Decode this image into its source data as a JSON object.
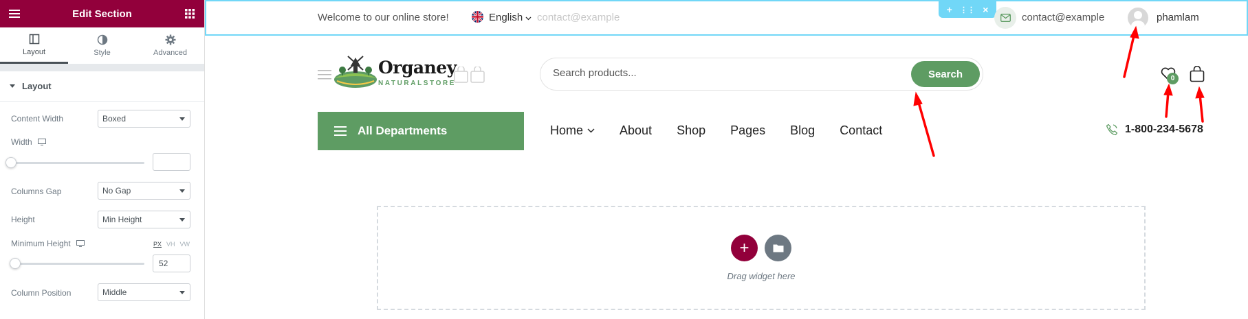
{
  "panel": {
    "title": "Edit Section",
    "tabs": [
      {
        "label": "Layout",
        "icon": "layout-icon",
        "active": true
      },
      {
        "label": "Style",
        "icon": "style-icon",
        "active": false
      },
      {
        "label": "Advanced",
        "icon": "gear-icon",
        "active": false
      }
    ],
    "section_title": "Layout",
    "controls": {
      "content_width": {
        "label": "Content Width",
        "value": "Boxed"
      },
      "width": {
        "label": "Width",
        "value": ""
      },
      "columns_gap": {
        "label": "Columns Gap",
        "value": "No Gap"
      },
      "height": {
        "label": "Height",
        "value": "Min Height"
      },
      "minimum_height": {
        "label": "Minimum Height",
        "value": "52",
        "units": [
          "PX",
          "VH",
          "VW"
        ]
      },
      "column_position": {
        "label": "Column Position",
        "value": "Middle"
      }
    }
  },
  "site": {
    "topbar": {
      "welcome": "Welcome to our online store!",
      "language": "English",
      "ghost_email": "contact@example",
      "email": "contact@example",
      "username": "phamlam",
      "tools": [
        "+",
        "⋮⋮",
        "×"
      ]
    },
    "logo": {
      "name": "Organey",
      "tagline": "NATURALSTORE"
    },
    "search": {
      "placeholder": "Search products...",
      "button": "Search"
    },
    "wishlist_count": "0",
    "departments": "All Departments",
    "nav": [
      "Home",
      "About",
      "Shop",
      "Pages",
      "Blog",
      "Contact"
    ],
    "phone": "1-800-234-5678",
    "dropzone_text": "Drag widget here"
  },
  "colors": {
    "brand": "#92003b",
    "green": "#5e9c63",
    "editor_highlight": "#71d7f7",
    "annotation_arrow": "#ff0000"
  }
}
